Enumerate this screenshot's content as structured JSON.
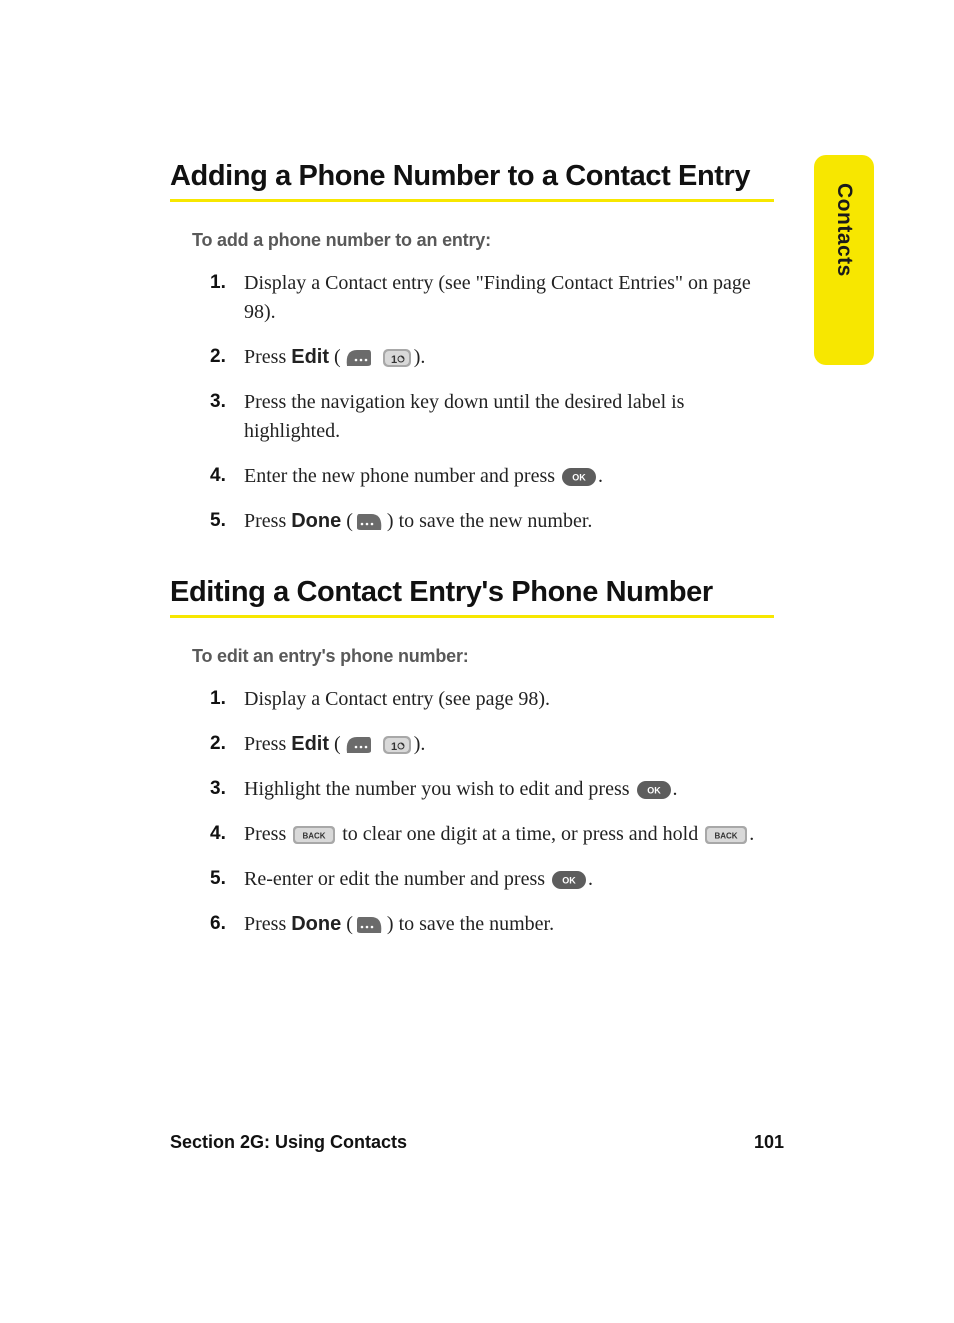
{
  "tab": {
    "label": "Contacts"
  },
  "section1": {
    "heading": "Adding a Phone Number to a Contact Entry",
    "intro": "To add a phone number to an entry:",
    "steps": {
      "s1": "Display a Contact entry (see \"Finding Contact Entries\" on page 98).",
      "s2_a": "Press ",
      "s2_bold": "Edit",
      "s2_b": " (",
      "s2_c": ").",
      "s3": "Press the navigation key down until the desired label is highlighted.",
      "s4_a": "Enter the new phone number and press ",
      "s4_b": ".",
      "s5_a": "Press ",
      "s5_bold": "Done",
      "s5_b": " (",
      "s5_c": ") to save the new number."
    }
  },
  "section2": {
    "heading": "Editing a Contact Entry's Phone Number",
    "intro": "To edit an entry's phone number:",
    "steps": {
      "s1": "Display a Contact entry (see page 98).",
      "s2_a": "Press ",
      "s2_bold": "Edit",
      "s2_b": " (",
      "s2_c": ").",
      "s3_a": "Highlight the number you wish to edit and press ",
      "s3_b": ".",
      "s4_a": "Press ",
      "s4_b": " to clear one digit at a time, or press and hold ",
      "s4_c": ".",
      "s5_a": "Re-enter or edit the number and press ",
      "s5_b": ".",
      "s6_a": "Press ",
      "s6_bold": "Done",
      "s6_b": " (",
      "s6_c": ") to save the number."
    }
  },
  "footer": {
    "left": "Section 2G: Using Contacts",
    "right": "101"
  },
  "nums": {
    "n1": "1.",
    "n2": "2.",
    "n3": "3.",
    "n4": "4.",
    "n5": "5.",
    "n6": "6."
  }
}
